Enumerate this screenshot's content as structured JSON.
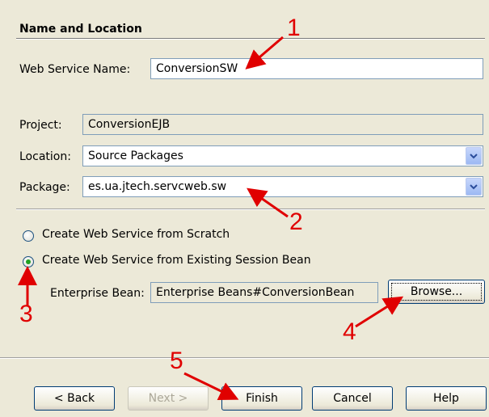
{
  "section": {
    "title": "Name and Location"
  },
  "form": {
    "web_service_name_label": "Web Service Name:",
    "web_service_name_value": "ConversionSW",
    "project_label": "Project:",
    "project_value": "ConversionEJB",
    "location_label": "Location:",
    "location_value": "Source Packages",
    "package_label": "Package:",
    "package_value": "es.ua.jtech.servcweb.sw"
  },
  "options": {
    "from_scratch_label": "Create Web Service from Scratch",
    "from_scratch_selected": false,
    "from_session_bean_label": "Create Web Service from Existing Session Bean",
    "from_session_bean_selected": true,
    "enterprise_bean_label": "Enterprise Bean:",
    "enterprise_bean_value": "Enterprise Beans#ConversionBean",
    "browse_label": "Browse..."
  },
  "buttons": {
    "back": "< Back",
    "next": "Next >",
    "finish": "Finish",
    "cancel": "Cancel",
    "help": "Help"
  },
  "annotations": {
    "n1": "1",
    "n2": "2",
    "n3": "3",
    "n4": "4",
    "n5": "5",
    "color": "#e00000"
  }
}
